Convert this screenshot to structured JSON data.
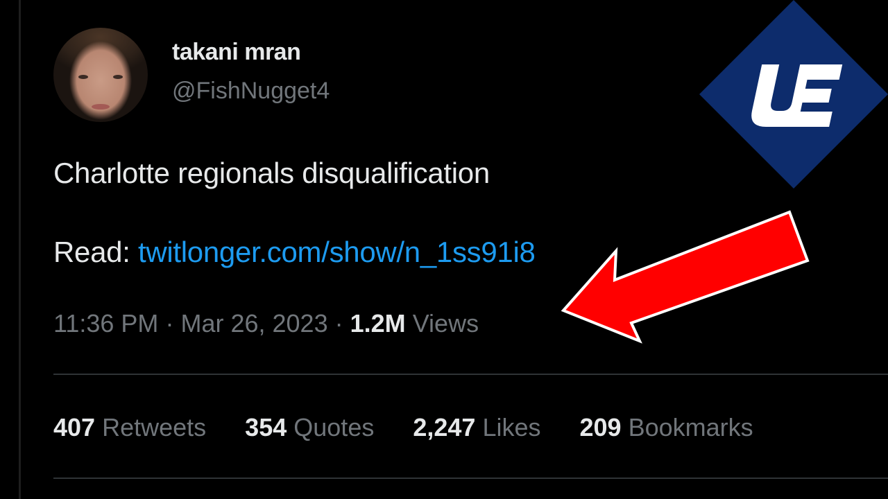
{
  "author": {
    "display_name": "takani mran",
    "handle": "@FishNugget4"
  },
  "tweet": {
    "text": "Charlotte regionals disqualification",
    "read_prefix": "Read:",
    "link": "twitlonger.com/show/n_1ss91i8"
  },
  "meta": {
    "time": "11:36 PM",
    "separator": "·",
    "date": "Mar 26, 2023",
    "views_count": "1.2M",
    "views_label": "Views"
  },
  "stats": [
    {
      "count": "407",
      "label": "Retweets"
    },
    {
      "count": "354",
      "label": "Quotes"
    },
    {
      "count": "2,247",
      "label": "Likes"
    },
    {
      "count": "209",
      "label": "Bookmarks"
    }
  ],
  "overlay": {
    "logo_text": "UE",
    "logo_color": "#0d2c6c",
    "arrow_color": "#ff0000"
  }
}
